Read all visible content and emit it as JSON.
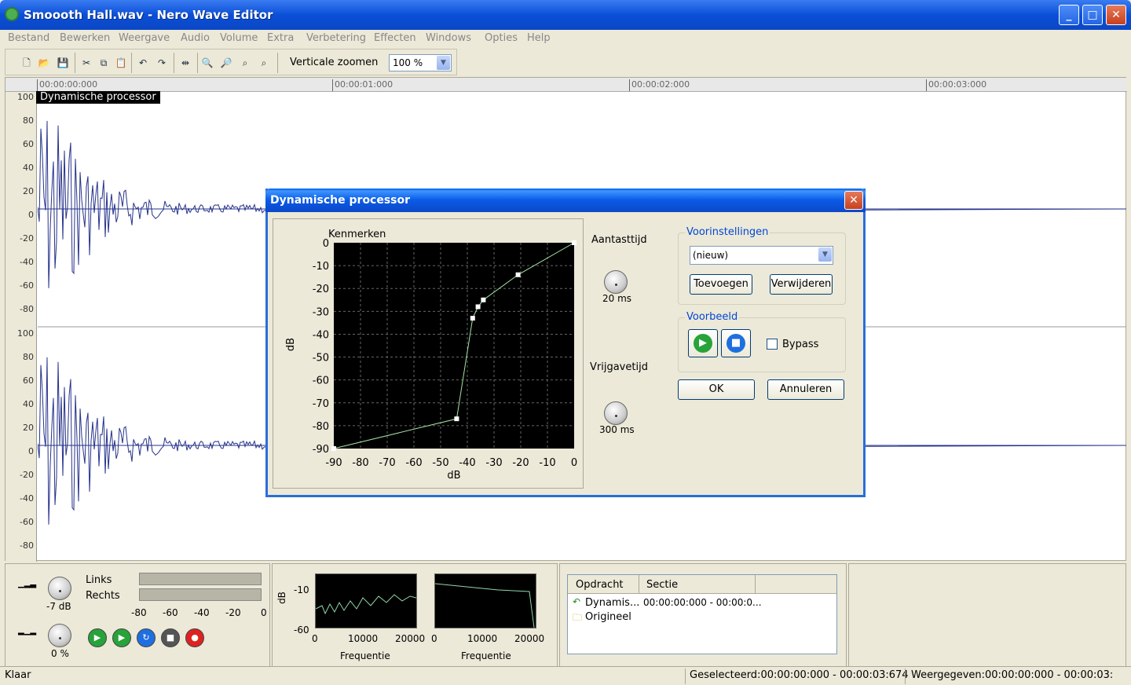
{
  "window": {
    "title": "Smoooth Hall.wav - Nero Wave Editor"
  },
  "menu": [
    "Bestand",
    "Bewerken",
    "Weergave",
    "Audio",
    "Volume",
    "Extra",
    "Verbetering",
    "Effecten",
    "Windows",
    "Opties",
    "Help"
  ],
  "toolbar": {
    "vertical_zoom_label": "Verticale zoomen",
    "vertical_zoom_value": "100 %"
  },
  "ruler": [
    "00:00:00:000",
    "00:00:01:000",
    "00:00:02:000",
    "00:00:03:000"
  ],
  "yaxis_top": [
    "100",
    "80",
    "60",
    "40",
    "20",
    "0",
    "-20",
    "-40",
    "-60",
    "-80"
  ],
  "yaxis_bottom": [
    "100",
    "80",
    "60",
    "40",
    "20",
    "0",
    "-20",
    "-40",
    "-60",
    "-80"
  ],
  "wave_label": "Dynamische processor",
  "dialog": {
    "title": "Dynamische processor",
    "curve_title": "Kenmerken",
    "ylabel": "dB",
    "xlabel": "dB",
    "attack_label": "Aantasttijd",
    "attack_value": "20 ms",
    "release_label": "Vrijgavetijd",
    "release_value": "300 ms",
    "presets_title": "Voorinstellingen",
    "preset_value": "(nieuw)",
    "add_button": "Toevoegen",
    "remove_button": "Verwijderen",
    "preview_title": "Voorbeeld",
    "bypass_label": "Bypass",
    "ok_button": "OK",
    "cancel_button": "Annuleren"
  },
  "chart_data": {
    "type": "line",
    "title": "Kenmerken",
    "xlabel": "dB",
    "ylabel": "dB",
    "xlim": [
      -90,
      0
    ],
    "ylim": [
      -90,
      0
    ],
    "x_ticks": [
      "-90",
      "-80",
      "-70",
      "-60",
      "-50",
      "-40",
      "-30",
      "-20",
      "-10",
      "0"
    ],
    "y_ticks": [
      "0",
      "-10",
      "-20",
      "-30",
      "-40",
      "-50",
      "-60",
      "-70",
      "-80",
      "-90"
    ],
    "grid": true,
    "series": [
      {
        "points": [
          [
            -90,
            -90
          ],
          [
            -44,
            -77
          ],
          [
            -38,
            -33
          ],
          [
            -36,
            -28
          ],
          [
            -34,
            -25
          ],
          [
            -21,
            -14
          ],
          [
            0,
            0
          ]
        ]
      }
    ],
    "line_color": "#a6e3a6"
  },
  "bottom": {
    "volume_value": "-7 dB",
    "balance_value": "0 %",
    "links_label": "Links",
    "rechts_label": "Rechts",
    "meter_ticks": [
      "-80",
      "-60",
      "-40",
      "-20",
      "0"
    ],
    "spec_ylabel": "dB",
    "spec_y_ticks": [
      "-10",
      "-60"
    ],
    "spec_x_ticks": [
      "0",
      "10000",
      "20000"
    ],
    "spec_xlabel": "Frequentie",
    "spec2_x_ticks": [
      "0",
      "10000",
      "20000"
    ],
    "spec2_xlabel": "Frequentie",
    "history_headers": [
      "Opdracht",
      "Sectie"
    ],
    "history_rows": [
      {
        "name": "Dynamis...",
        "section": "00:00:00:000 - 00:00:0..."
      },
      {
        "name": "Origineel",
        "section": ""
      }
    ]
  },
  "status": {
    "left": "Klaar",
    "selected": "Geselecteerd:00:00:00:000 - 00:00:03:674",
    "shown": "Weergegeven:00:00:00:000 - 00:00:03:"
  }
}
